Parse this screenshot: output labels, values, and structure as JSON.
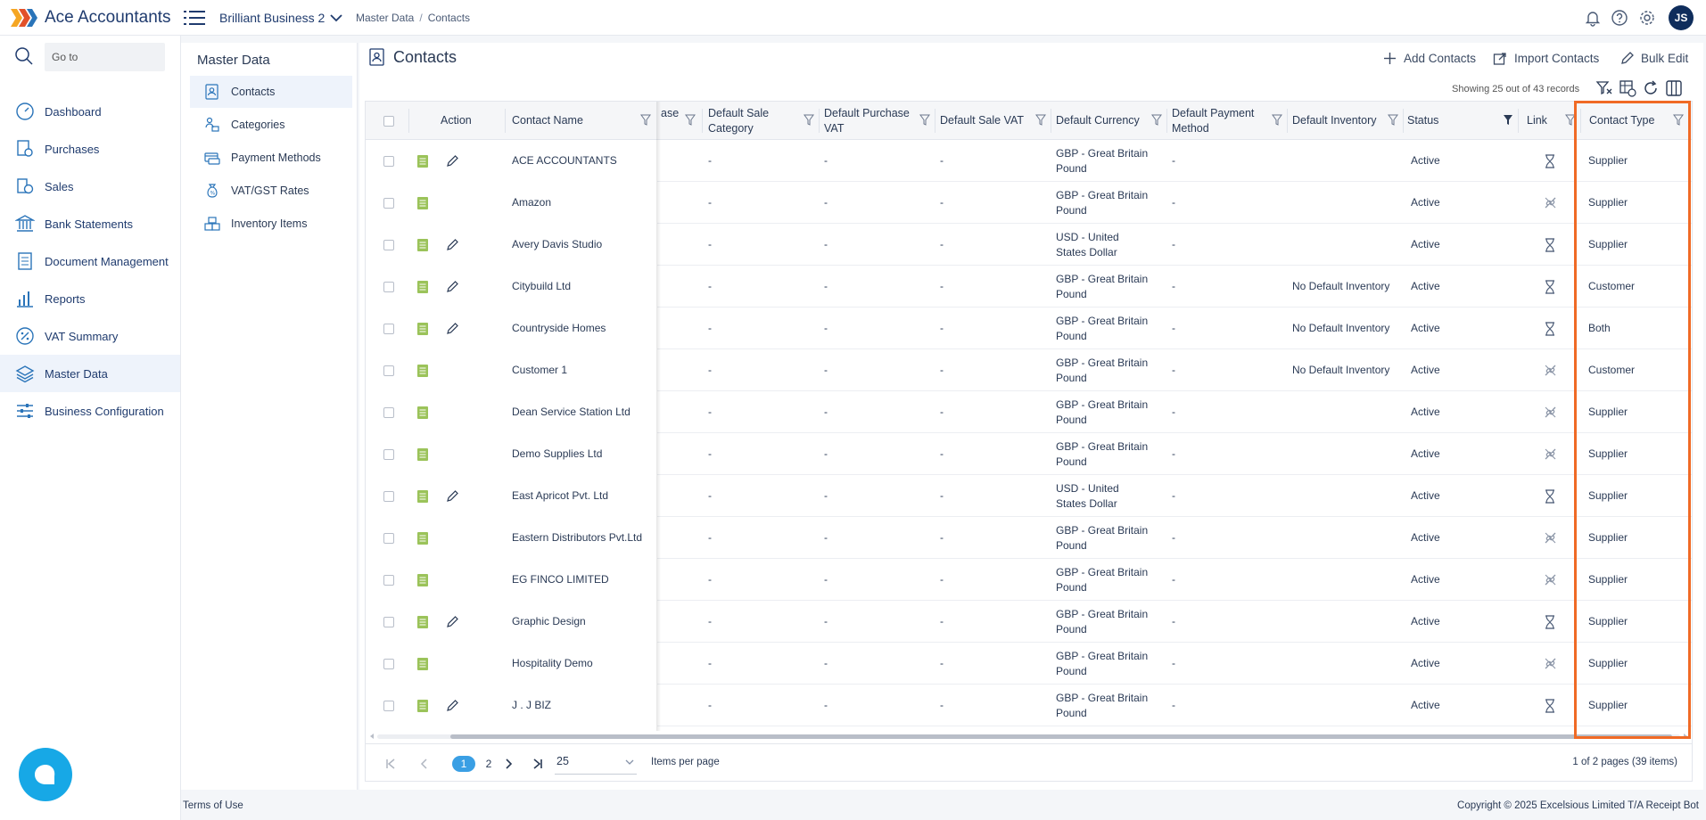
{
  "app": {
    "brand": "Ace Accountants"
  },
  "header": {
    "business": "Brilliant Business 2",
    "breadcrumb": [
      "Master Data",
      "Contacts"
    ],
    "avatar_initials": "JS"
  },
  "sidebar": {
    "goto_placeholder": "Go to",
    "items": [
      {
        "label": "Dashboard",
        "icon": "dashboard-icon"
      },
      {
        "label": "Purchases",
        "icon": "purchases-icon"
      },
      {
        "label": "Sales",
        "icon": "sales-icon"
      },
      {
        "label": "Bank Statements",
        "icon": "bank-icon"
      },
      {
        "label": "Document Management",
        "icon": "document-icon"
      },
      {
        "label": "Reports",
        "icon": "reports-icon"
      },
      {
        "label": "VAT Summary",
        "icon": "vat-icon"
      },
      {
        "label": "Master Data",
        "icon": "layers-icon",
        "active": true
      },
      {
        "label": "Business Configuration",
        "icon": "sliders-icon"
      }
    ]
  },
  "subnav": {
    "title": "Master Data",
    "items": [
      {
        "label": "Contacts",
        "active": true
      },
      {
        "label": "Categories"
      },
      {
        "label": "Payment Methods"
      },
      {
        "label": "VAT/GST Rates"
      },
      {
        "label": "Inventory Items"
      }
    ]
  },
  "main": {
    "title": "Contacts",
    "actions": {
      "add": "Add Contacts",
      "import": "Import Contacts",
      "bulk": "Bulk Edit"
    },
    "records": "Showing 25 out of 43 records"
  },
  "grid": {
    "headers": {
      "action": "Action",
      "contact_name": "Contact Name",
      "purchase_partial": "ase",
      "default_sale_category": "Default Sale Category",
      "default_purchase_vat": "Default Purchase VAT",
      "default_sale_vat": "Default Sale VAT",
      "default_currency": "Default Currency",
      "default_payment_method": "Default Payment Method",
      "default_inventory": "Default Inventory",
      "status": "Status",
      "link": "Link",
      "contact_type": "Contact Type"
    },
    "rows": [
      {
        "name": "ACE ACCOUNTANTS",
        "editable": true,
        "sale_cat": "-",
        "purch_vat": "-",
        "sale_vat": "-",
        "currency": "GBP - Great Britain Pound",
        "payment": "-",
        "inventory": "",
        "status": "Active",
        "link": "hourglass",
        "type": "Supplier"
      },
      {
        "name": "Amazon",
        "editable": false,
        "sale_cat": "-",
        "purch_vat": "-",
        "sale_vat": "-",
        "currency": "GBP - Great Britain Pound",
        "payment": "-",
        "inventory": "",
        "status": "Active",
        "link": "unlinked",
        "type": "Supplier"
      },
      {
        "name": "Avery Davis Studio",
        "editable": true,
        "sale_cat": "-",
        "purch_vat": "-",
        "sale_vat": "-",
        "currency": "USD - United States Dollar",
        "payment": "-",
        "inventory": "",
        "status": "Active",
        "link": "hourglass",
        "type": "Supplier"
      },
      {
        "name": "Citybuild Ltd",
        "editable": true,
        "sale_cat": "-",
        "purch_vat": "-",
        "sale_vat": "-",
        "currency": "GBP - Great Britain Pound",
        "payment": "-",
        "inventory": "No Default Inventory",
        "status": "Active",
        "link": "hourglass",
        "type": "Customer"
      },
      {
        "name": "Countryside Homes",
        "editable": true,
        "sale_cat": "-",
        "purch_vat": "-",
        "sale_vat": "-",
        "currency": "GBP - Great Britain Pound",
        "payment": "-",
        "inventory": "No Default Inventory",
        "status": "Active",
        "link": "hourglass",
        "type": "Both"
      },
      {
        "name": "Customer 1",
        "editable": false,
        "sale_cat": "-",
        "purch_vat": "-",
        "sale_vat": "-",
        "currency": "GBP - Great Britain Pound",
        "payment": "-",
        "inventory": "No Default Inventory",
        "status": "Active",
        "link": "unlinked",
        "type": "Customer"
      },
      {
        "name": "Dean Service Station Ltd",
        "editable": false,
        "sale_cat": "-",
        "purch_vat": "-",
        "sale_vat": "-",
        "currency": "GBP - Great Britain Pound",
        "payment": "-",
        "inventory": "",
        "status": "Active",
        "link": "unlinked",
        "type": "Supplier"
      },
      {
        "name": "Demo Supplies Ltd",
        "editable": false,
        "sale_cat": "-",
        "purch_vat": "-",
        "sale_vat": "-",
        "currency": "GBP - Great Britain Pound",
        "payment": "-",
        "inventory": "",
        "status": "Active",
        "link": "unlinked",
        "type": "Supplier"
      },
      {
        "name": "East Apricot Pvt. Ltd",
        "editable": true,
        "sale_cat": "-",
        "purch_vat": "-",
        "sale_vat": "-",
        "currency": "USD - United States Dollar",
        "payment": "-",
        "inventory": "",
        "status": "Active",
        "link": "hourglass",
        "type": "Supplier"
      },
      {
        "name": "Eastern Distributors Pvt.Ltd",
        "editable": false,
        "sale_cat": "-",
        "purch_vat": "-",
        "sale_vat": "-",
        "currency": "GBP - Great Britain Pound",
        "payment": "-",
        "inventory": "",
        "status": "Active",
        "link": "unlinked",
        "type": "Supplier"
      },
      {
        "name": "EG FINCO LIMITED",
        "editable": false,
        "sale_cat": "-",
        "purch_vat": "-",
        "sale_vat": "-",
        "currency": "GBP - Great Britain Pound",
        "payment": "-",
        "inventory": "",
        "status": "Active",
        "link": "unlinked",
        "type": "Supplier"
      },
      {
        "name": "Graphic Design",
        "editable": true,
        "sale_cat": "-",
        "purch_vat": "-",
        "sale_vat": "-",
        "currency": "GBP - Great Britain Pound",
        "payment": "-",
        "inventory": "",
        "status": "Active",
        "link": "hourglass",
        "type": "Supplier"
      },
      {
        "name": "Hospitality Demo",
        "editable": false,
        "sale_cat": "-",
        "purch_vat": "-",
        "sale_vat": "-",
        "currency": "GBP - Great Britain Pound",
        "payment": "-",
        "inventory": "",
        "status": "Active",
        "link": "unlinked",
        "type": "Supplier"
      },
      {
        "name": "J . J BIZ",
        "editable": true,
        "sale_cat": "-",
        "purch_vat": "-",
        "sale_vat": "-",
        "currency": "GBP - Great Britain Pound",
        "payment": "-",
        "inventory": "",
        "status": "Active",
        "link": "hourglass",
        "type": "Supplier"
      }
    ]
  },
  "pager": {
    "pages": [
      "1",
      "2"
    ],
    "current": "1",
    "page_size": "25",
    "page_size_label": "Items per page",
    "info": "1 of 2 pages (39 items)"
  },
  "footer": {
    "terms": "Terms of Use",
    "copyright": "Copyright © 2025 Excelsious Limited T/A Receipt Bot"
  },
  "colors": {
    "accent": "#3a9fe4",
    "highlight": "#f06a25",
    "icon_green": "#9bc35a",
    "navy": "#1f3b6e"
  }
}
